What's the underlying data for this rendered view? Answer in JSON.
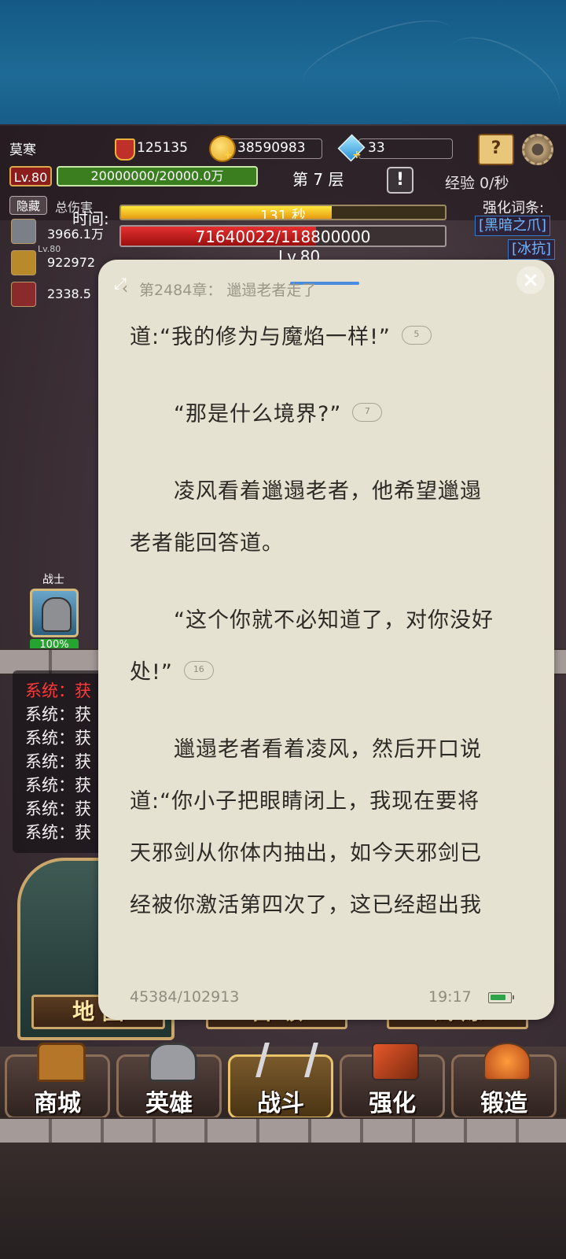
{
  "game": {
    "player_name": "莫寒",
    "power": "125135",
    "gold": "38590983",
    "gems": "33",
    "level": "Lv.80",
    "exp": "20000000/20000.0万",
    "floor": "第 7 层",
    "exp_rate": "经验 0/秒",
    "hide_label": "隐藏",
    "total_damage_label": "总伤害",
    "time_label": "时间:",
    "time_text": "131 秒",
    "time_fraction": 0.65,
    "boss_hp_text": "71640022/118800000",
    "boss_hp_fraction": 0.603,
    "boss_level": "Lv.80",
    "enhance_title": "强化词条:",
    "enhance_tags": [
      "[黑暗之爪]",
      "[冰抗]"
    ],
    "hero_rows": [
      {
        "value": "3966.1万",
        "sub": ""
      },
      {
        "value": "922972",
        "sub": "Lv.80"
      },
      {
        "value": "2338.5",
        "sub": ""
      }
    ],
    "warrior_label": "战士",
    "warrior_pct": "100%",
    "system_lines": [
      "系统：获",
      "系统：获",
      "系统：获",
      "系统：获",
      "系统：获",
      "系统：获",
      "系统：获"
    ],
    "system_first": "系统：获",
    "cards": {
      "map": "地 图",
      "boss": "首 领",
      "trial": "试 炼"
    },
    "boss_badge": "!",
    "nav": [
      {
        "label": "商城",
        "icon": "chest-icon"
      },
      {
        "label": "英雄",
        "icon": "helmet-icon"
      },
      {
        "label": "战斗",
        "icon": "swords-icon",
        "active": true
      },
      {
        "label": "强化",
        "icon": "hammer-icon"
      },
      {
        "label": "锻造",
        "icon": "anvil-icon"
      }
    ],
    "colors": {
      "exp_green": "#3a7e20",
      "hp_red": "#e53030",
      "tag_blue": "#6fb7ff"
    }
  },
  "reader": {
    "chapter_title": "第2484章：  邋遢老者走了",
    "close_label": "×",
    "lines": [
      {
        "text": "道:“我的修为与魔焰一样!”",
        "comments": "5"
      },
      {
        "text": "　　“那是什么境界?”",
        "comments": "7"
      },
      {
        "text": "　　凌风看着邋遢老者，他希望邋遢",
        "comments": ""
      },
      {
        "text": "老者能回答道。",
        "comments": ""
      },
      {
        "text": "　　“这个你就不必知道了，对你没好",
        "comments": ""
      },
      {
        "text": "处!”",
        "comments": "16"
      },
      {
        "text": "　　邋遢老者看着凌风，然后开口说",
        "comments": ""
      },
      {
        "text": "道:“你小子把眼睛闭上，我现在要将",
        "comments": ""
      },
      {
        "text": "天邪剑从你体内抽出，如今天邪剑已",
        "comments": ""
      },
      {
        "text": "经被你激活第四次了，这已经超出我",
        "comments": ""
      }
    ],
    "progress": "45384/102913",
    "clock": "19:17",
    "battery_fraction": 0.85
  }
}
